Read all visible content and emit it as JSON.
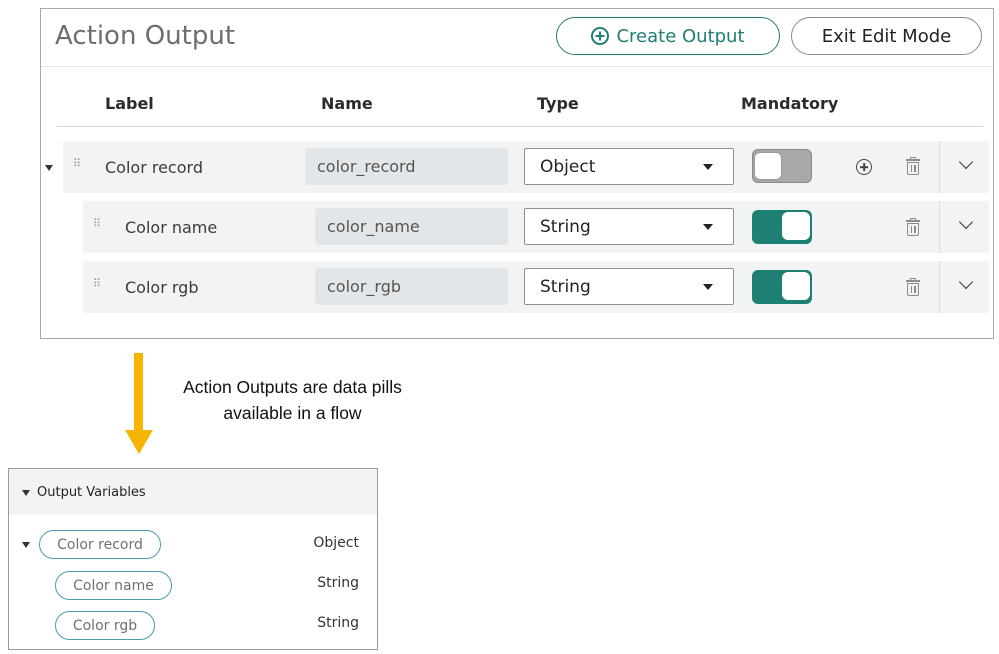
{
  "panel": {
    "title": "Action Output",
    "create_button": "Create Output",
    "exit_button": "Exit Edit Mode"
  },
  "columns": {
    "label": "Label",
    "name": "Name",
    "type": "Type",
    "mandatory": "Mandatory"
  },
  "rows": [
    {
      "label": "Color record",
      "name": "color_record",
      "type": "Object",
      "mandatory": false,
      "expanded": true
    },
    {
      "label": "Color name",
      "name": "color_name",
      "type": "String",
      "mandatory": true
    },
    {
      "label": "Color rgb",
      "name": "color_rgb",
      "type": "String",
      "mandatory": true
    }
  ],
  "caption": {
    "line1": "Action Outputs are data pills",
    "line2": "available in a flow"
  },
  "output_variables": {
    "title": "Output Variables",
    "items": [
      {
        "label": "Color record",
        "type": "Object"
      },
      {
        "label": "Color name",
        "type": "String"
      },
      {
        "label": "Color rgb",
        "type": "String"
      }
    ]
  },
  "colors": {
    "accent": "#1e7f73",
    "arrow": "#f4b400",
    "pill_border": "#4a9cb0"
  },
  "icons": [
    "plus-circle-icon",
    "drag-handle-icon",
    "caret-down-icon",
    "chevron-down-icon",
    "trash-icon",
    "add-child-icon"
  ]
}
